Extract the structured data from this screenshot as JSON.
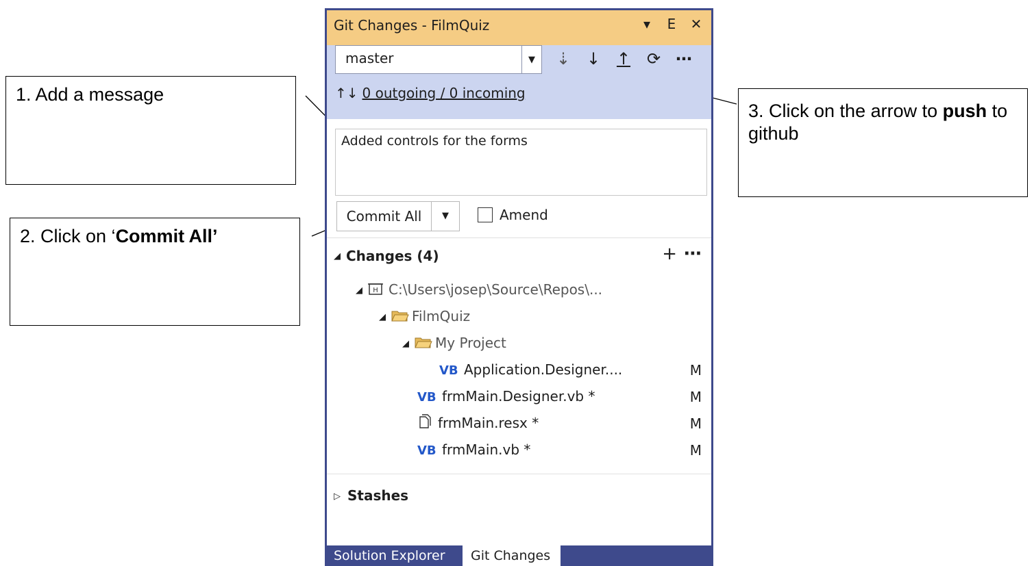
{
  "annotations": {
    "note1": "1. Add a message",
    "note2_prefix": "2. Click on ‘",
    "note2_bold": "Commit All’",
    "note3_prefix": "3. Click on the arrow to ",
    "note3_bold": "push",
    "note3_suffix": " to github"
  },
  "panel": {
    "title": "Git Changes - FilmQuiz",
    "title_icons": [
      "dropdown-icon",
      "pin-icon",
      "close-icon"
    ],
    "branch": "master",
    "actions": [
      "fetch-icon",
      "pull-icon",
      "push-icon",
      "sync-icon",
      "more-icon"
    ],
    "sync_status": "0 outgoing / 0 incoming",
    "commit_message": "Added controls for the forms",
    "commit_button": "Commit All",
    "amend_label": "Amend",
    "changes_header": "Changes (4)",
    "tree": [
      {
        "label": "C:\\Users\\josep\\Source\\Repos\\...",
        "type": "repo"
      },
      {
        "label": "FilmQuiz",
        "type": "folder"
      },
      {
        "label": "My Project",
        "type": "folder"
      },
      {
        "label": "Application.Designer....",
        "type": "vb",
        "status": "M"
      },
      {
        "label": "frmMain.Designer.vb *",
        "type": "vb",
        "status": "M"
      },
      {
        "label": "frmMain.resx *",
        "type": "resx",
        "status": "M"
      },
      {
        "label": "frmMain.vb *",
        "type": "vb",
        "status": "M"
      }
    ],
    "vb_badge": "VB",
    "stashes": "Stashes",
    "tabs": [
      "Solution Explorer",
      "Git Changes"
    ],
    "colors": {
      "titlebar": "#f5cc84",
      "header": "#ccd5f0",
      "frame": "#3e4a8c",
      "vb": "#2358c9"
    }
  }
}
